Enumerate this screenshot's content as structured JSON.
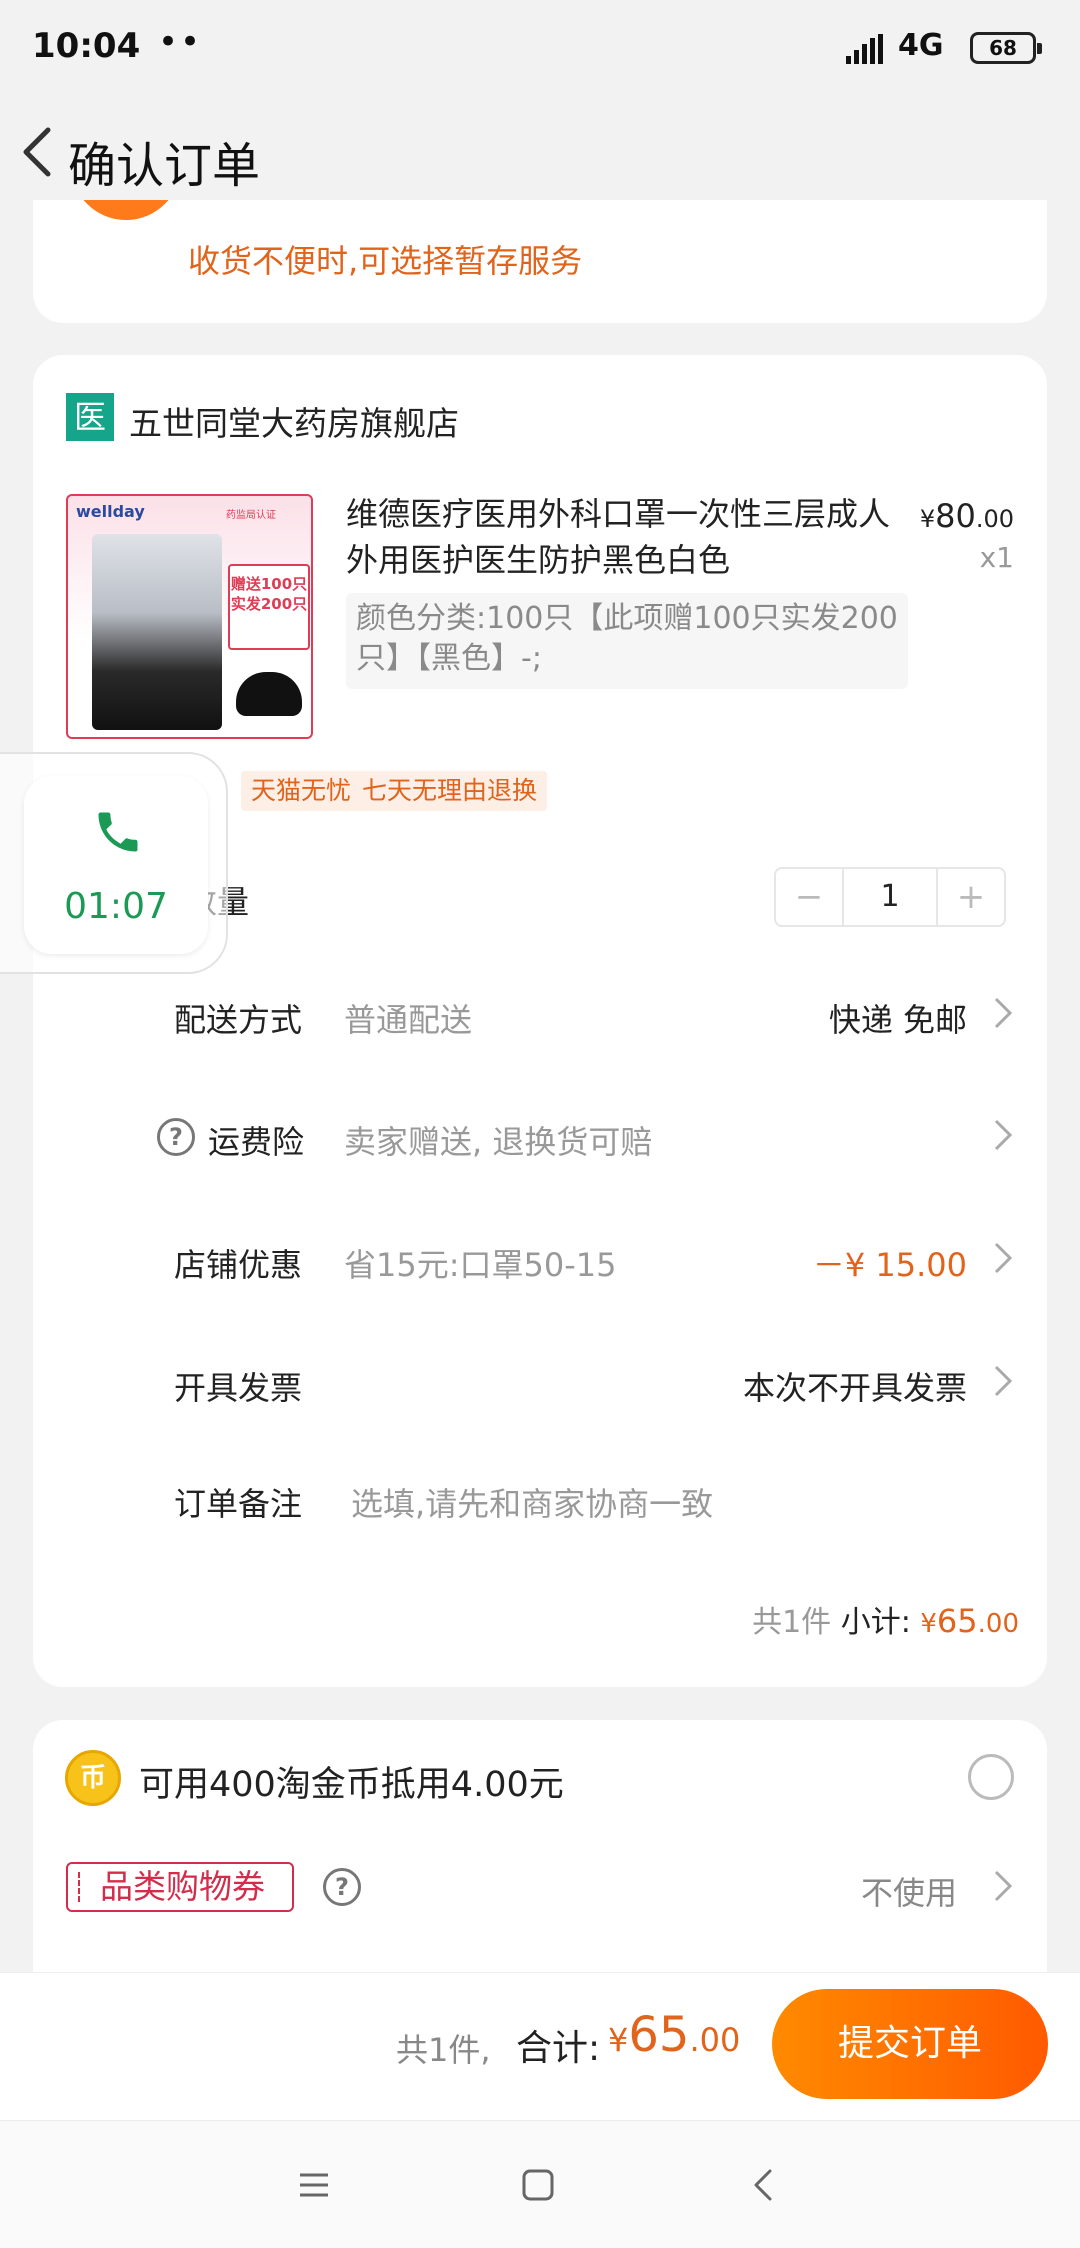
{
  "status_bar": {
    "time": "10:04",
    "dots": "••",
    "network": "4G",
    "battery": "68"
  },
  "nav": {
    "title": "确认订单"
  },
  "notice": {
    "text": "收货不便时,可选择暂存服务"
  },
  "shop": {
    "badge": "医",
    "name": "五世同堂大药房旗舰店"
  },
  "product": {
    "title": "维德医疗医用外科口罩一次性三层成人外用医护医生防护黑色白色",
    "price_currency": "¥",
    "price_int": "80",
    "price_dec": ".00",
    "qty": "x1",
    "sku": "颜色分类:100只【此项赠100只实发200只】【黑色】-;",
    "image": {
      "brand": "wellday",
      "promo": "赠送100只\n实发200只",
      "tag": "药监局认证"
    },
    "tags": [
      "天猫无忧购",
      "七天无理由退换"
    ]
  },
  "rows": {
    "quantity_label": "购买数量",
    "quantity_value": "1",
    "minus": "−",
    "plus": "+",
    "delivery_label": "配送方式",
    "delivery_value": "普通配送",
    "delivery_right": "快递 免邮",
    "insurance_label": "运费险",
    "insurance_value": "卖家赠送, 退换货可赔",
    "discount_label": "店铺优惠",
    "discount_value": "省15元:口罩50-15",
    "discount_right": "－¥ 15.00",
    "invoice_label": "开具发票",
    "invoice_right": "本次不开具发票",
    "remark_label": "订单备注",
    "remark_placeholder": "选填,请先和商家协商一致"
  },
  "subtotal": {
    "count": "共1件",
    "label": "小计:",
    "currency": "¥",
    "int": "65",
    "dec": ".00"
  },
  "coin": {
    "icon": "币",
    "text": "可用400淘金币抵用4.00元"
  },
  "coupon": {
    "label": "品类购物券",
    "value": "不使用"
  },
  "call": {
    "time": "01:07"
  },
  "bottom": {
    "count": "共1件,",
    "total_label": "合计:",
    "currency": "¥",
    "int": "65",
    "dec": ".00",
    "submit": "提交订单"
  },
  "colors": {
    "accent": "#ff6a00",
    "price": "#e2631a",
    "shop_badge": "#14a58a",
    "call_green": "#1a9a55"
  }
}
